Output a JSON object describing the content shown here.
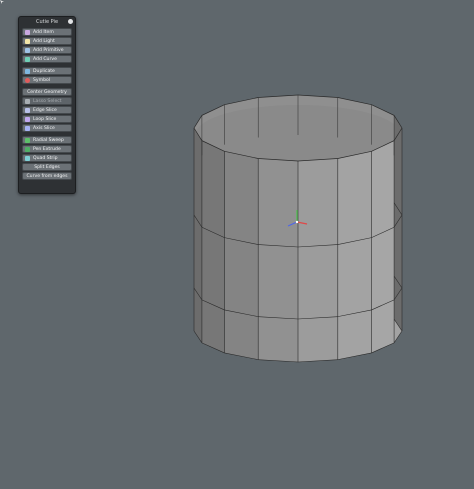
{
  "pie_menu": {
    "title": "Cutie Pie",
    "items": [
      {
        "label": "Add Item",
        "icon": "add-item-icon"
      },
      {
        "label": "Add Light",
        "icon": "add-light-icon"
      },
      {
        "label": "Add Primitive",
        "icon": "add-primitive-icon"
      },
      {
        "label": "Add Curve",
        "icon": "add-curve-icon"
      },
      {
        "label": "Duplicate",
        "icon": "duplicate-icon"
      },
      {
        "label": "Symbol",
        "icon": "symbol-icon"
      },
      {
        "label": "Center Geometry",
        "icon": ""
      },
      {
        "label": "Lasso Select",
        "icon": "lasso-select-icon"
      },
      {
        "label": "Edge Slice",
        "icon": "edge-slice-icon"
      },
      {
        "label": "Loop Slice",
        "icon": "loop-slice-icon"
      },
      {
        "label": "Axis Slice",
        "icon": "axis-slice-icon"
      },
      {
        "label": "Radial Sweep",
        "icon": "radial-sweep-icon"
      },
      {
        "label": "Pen Extrude",
        "icon": "pen-extrude-icon"
      },
      {
        "label": "Quad Strip",
        "icon": "quad-strip-icon"
      },
      {
        "label": "Split Edges",
        "icon": ""
      },
      {
        "label": "Curve from edges",
        "icon": ""
      }
    ]
  },
  "viewport": {
    "background_color": "#5f676c",
    "mesh_color": "#a9a9a9",
    "edge_color": "#2a2a2a",
    "gizmo_colors": {
      "x": "#e04848",
      "y": "#4ec04e",
      "z": "#4f67e8"
    }
  }
}
